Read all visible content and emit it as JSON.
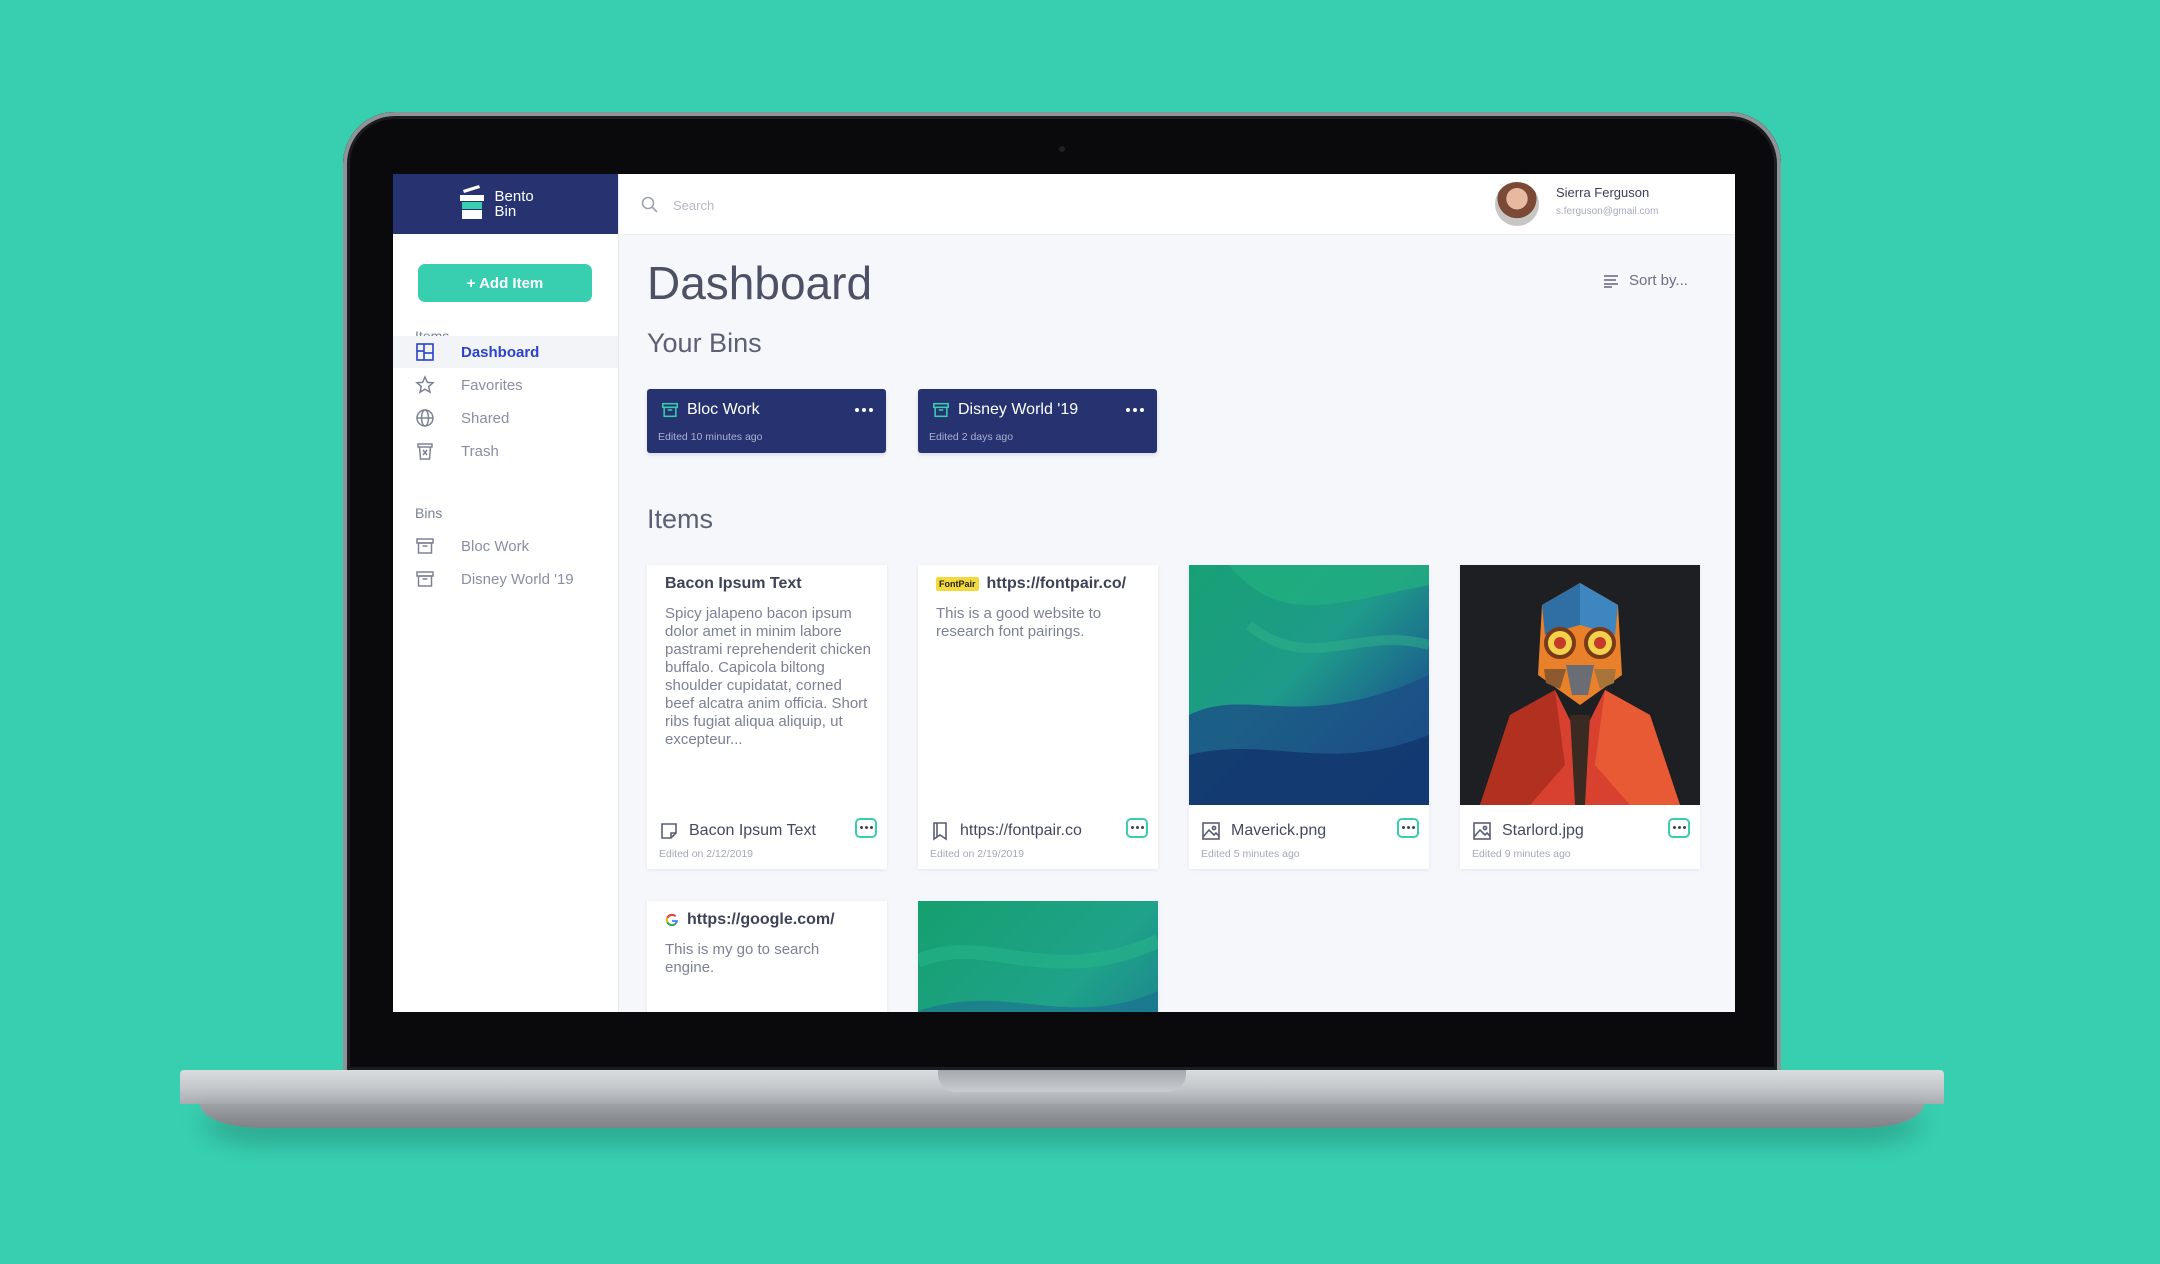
{
  "brand": {
    "name_line1": "Bento",
    "name_line2": "Bin"
  },
  "sidebar": {
    "add_button": "+ Add Item",
    "items_label": "Items",
    "items": [
      {
        "label": "Dashboard",
        "icon": "dashboard-icon",
        "active": true
      },
      {
        "label": "Favorites",
        "icon": "star-icon"
      },
      {
        "label": "Shared",
        "icon": "globe-icon"
      },
      {
        "label": "Trash",
        "icon": "trash-icon"
      }
    ],
    "bins_label": "Bins",
    "bins": [
      {
        "label": "Bloc Work",
        "icon": "archive-box-icon"
      },
      {
        "label": "Disney World '19",
        "icon": "archive-box-icon"
      }
    ]
  },
  "search": {
    "placeholder": "Search"
  },
  "user": {
    "name": "Sierra Ferguson",
    "email": "s.ferguson@gmail.com"
  },
  "main": {
    "title": "Dashboard",
    "sort_label": "Sort by...",
    "bins_title": "Your Bins",
    "bins": [
      {
        "name": "Bloc Work",
        "edited": "Edited 10 minutes ago"
      },
      {
        "name": "Disney World '19",
        "edited": "Edited 2 days ago"
      }
    ],
    "items_title": "Items",
    "items": [
      {
        "type": "text",
        "title": "Bacon Ipsum Text",
        "body": "Spicy jalapeno bacon ipsum dolor amet in minim labore pastrami reprehenderit chicken buffalo. Capicola biltong shoulder cupidatat, corned beef alcatra anim officia. Short ribs fugiat aliqua aliquip, ut excepteur...",
        "footer_name": "Bacon Ipsum Text",
        "edited": "Edited on 2/12/2019"
      },
      {
        "type": "link",
        "badge": "FontPair",
        "title": "https://fontpair.co/",
        "body": "This is a good website to research font pairings.",
        "footer_name": "https://fontpair.co",
        "edited": "Edited on 2/19/2019"
      },
      {
        "type": "image",
        "footer_name": "Maverick.png",
        "edited": "Edited 5 minutes ago"
      },
      {
        "type": "image",
        "footer_name": "Starlord.jpg",
        "edited": "Edited 9 minutes ago"
      },
      {
        "type": "link",
        "title": "https://google.com/",
        "body": "This is my go to search engine."
      },
      {
        "type": "image"
      }
    ]
  },
  "colors": {
    "accent": "#37cfb0",
    "navy": "#273370",
    "active_nav": "#2b43c9"
  }
}
